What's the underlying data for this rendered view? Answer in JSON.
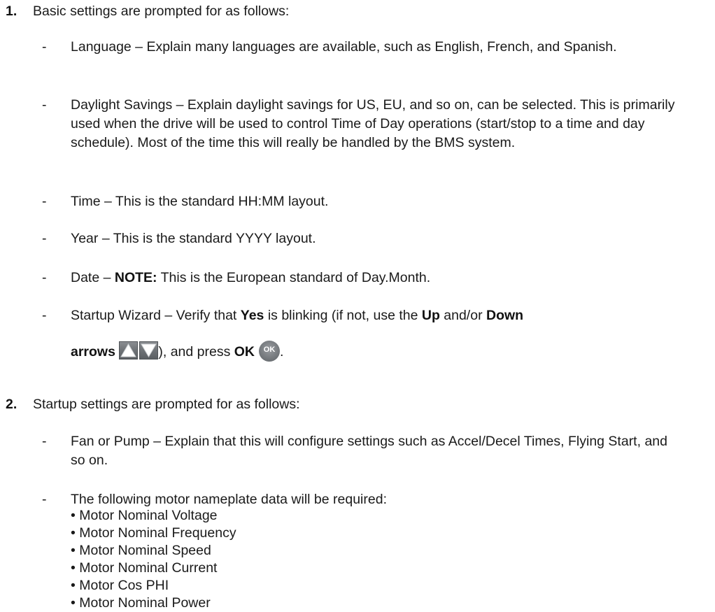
{
  "step1": {
    "number": "1.",
    "intro": "Basic settings are prompted for as follows:",
    "items": {
      "language": "Language – Explain many languages are available, such as English, French, and Spanish.",
      "daylight": "Daylight Savings – Explain daylight savings for US, EU, and so on, can be selected. This is primarily used when the drive will be used to control Time of Day operations (start/stop to a time and day schedule). Most of the time this will really be handled by the BMS system.",
      "time": "Time – This is the standard HH:MM layout.",
      "year": "Year – This is the standard YYYY layout.",
      "date_prefix": "Date – ",
      "date_note_label": "NOTE:",
      "date_suffix": " This is the European standard of Day.Month.",
      "wizard_prefix": "Startup Wizard – Verify that ",
      "wizard_yes": "Yes",
      "wizard_mid": " is blinking (if not, use the ",
      "wizard_up": "Up",
      "wizard_andor": " and/or ",
      "wizard_down": "Down",
      "wizard_arrows": "arrows",
      "wizard_press": "), and press ",
      "wizard_ok": "OK",
      "wizard_end": ".",
      "ok_icon_text": "OK"
    }
  },
  "step2": {
    "number": "2.",
    "intro": "Startup settings are prompted for as follows:",
    "items": {
      "fan_pump": "Fan or Pump – Explain that this will configure settings such as Accel/Decel Times, Flying Start, and so on.",
      "nameplate_intro": "The following motor nameplate data will be required:",
      "nameplate_list": [
        "• Motor Nominal Voltage",
        "• Motor Nominal Frequency",
        "• Motor Nominal Speed",
        "• Motor Nominal Current",
        "• Motor Cos PHI",
        "• Motor Nominal Power"
      ]
    }
  },
  "dash": "-",
  "colors": {
    "text": "#1a1a1a",
    "icon_gray": "#6e7276"
  },
  "icons": [
    "up-arrow-icon",
    "down-arrow-icon",
    "ok-button-icon"
  ]
}
